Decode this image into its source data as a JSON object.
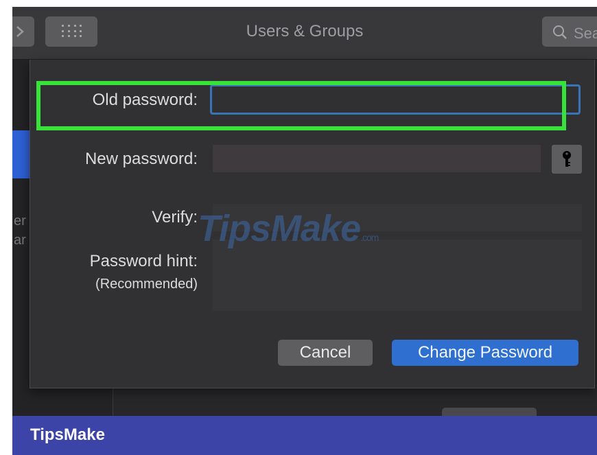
{
  "window": {
    "title": "Users & Groups",
    "search_placeholder": "Sea"
  },
  "sidebar": {
    "partial_text": "er\nar"
  },
  "dialog": {
    "old_password_label": "Old password:",
    "new_password_label": "New password:",
    "verify_label": "Verify:",
    "hint_label": "Password hint:",
    "hint_sub_label": "(Recommended)",
    "cancel_label": "Cancel",
    "change_label": "Change Password",
    "key_icon": "key-icon"
  },
  "watermark": {
    "text": "TipsMake",
    "suffix": ".com"
  },
  "footer": {
    "brand": "TipsMake"
  },
  "colors": {
    "highlight": "#39e13b",
    "primary_button": "#2f6fd0",
    "frame": "#3c44a8"
  }
}
